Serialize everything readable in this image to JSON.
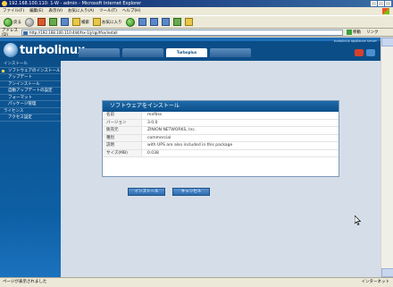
{
  "window": {
    "title": "192.168.100.110: 1-W - admin - Microsoft Internet Explorer"
  },
  "menubar": {
    "items": [
      "ファイル(F)",
      "編集(E)",
      "表示(V)",
      "お気に入り(A)",
      "ツール(T)",
      "ヘルプ(H)"
    ]
  },
  "toolbar": {
    "back_label": "戻る",
    "search_label": "検索",
    "favorites_label": "お気に入り"
  },
  "address": {
    "label": "アドレス(D)",
    "url": "http://192.168.100.110:444/fsx-1/j/cgi/tfsx/install",
    "go_label": "移動",
    "links_label": "リンク"
  },
  "header": {
    "logo_text": "turbolinux",
    "top_link": "turbolinux appliance server",
    "tabs": [
      "",
      "",
      "Turboplus",
      ""
    ]
  },
  "sidebar": {
    "items": [
      {
        "label": "インストール",
        "head": true
      },
      {
        "label": "ソフトウェアのインストール",
        "head": false
      },
      {
        "label": "アップデート",
        "head": false
      },
      {
        "label": "アンインストール",
        "head": false
      },
      {
        "label": "自動アップデートの設定",
        "head": false
      },
      {
        "label": "フォーマット",
        "head": false
      },
      {
        "label": "パッケージ管理",
        "head": false
      },
      {
        "label": "ライセンス",
        "head": true
      },
      {
        "label": "アクセス設定",
        "head": false
      }
    ]
  },
  "dialog": {
    "title": "ソフトウェアをインストール",
    "rows": [
      {
        "key": "名前",
        "value": "mxfbss"
      },
      {
        "key": "バージョン",
        "value": "3.0.0"
      },
      {
        "key": "販売元",
        "value": "ZINION NETWORKS, Inc."
      },
      {
        "key": "種別",
        "value": "commercial"
      },
      {
        "key": "説明",
        "value": "with UPS are also included in this package"
      },
      {
        "key": "サイズ(MB)",
        "value": "0.038"
      }
    ]
  },
  "buttons": {
    "install": "インストール",
    "back": "キャンセル"
  },
  "statusbar": {
    "left": "ページが表示されました",
    "zone": "インターネット"
  }
}
